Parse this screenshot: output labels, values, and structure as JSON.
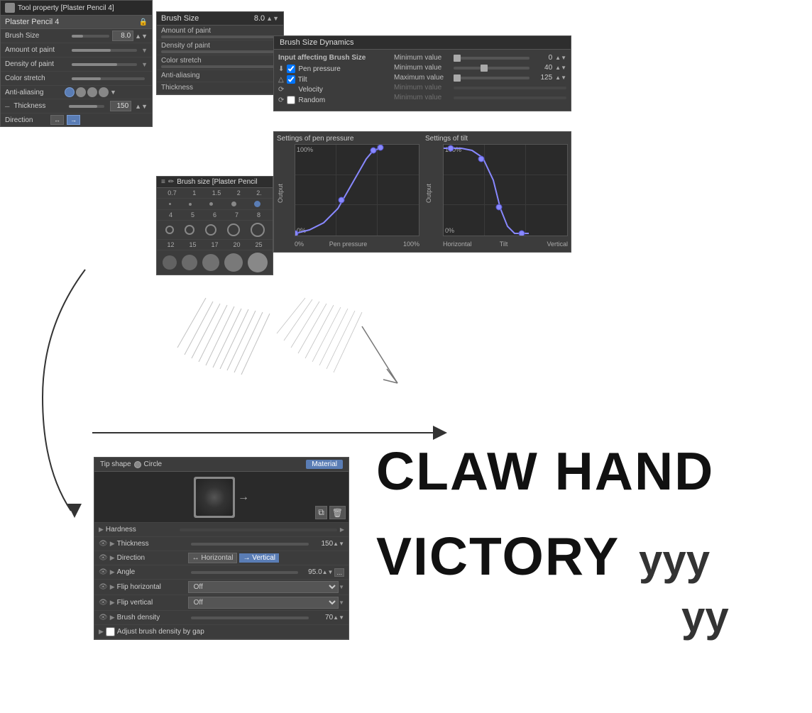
{
  "tool_property": {
    "title": "Tool property [Plaster Pencil 4]",
    "brush_name": "Plaster Pencil 4",
    "brush_size_label": "Brush Size",
    "brush_size_value": "8.0",
    "amount_of_paint_label": "Amount ot paint",
    "density_of_paint_label": "Density of paint",
    "color_stretch_label": "Color stretch",
    "anti_aliasing_label": "Anti-aliasing",
    "thickness_label": "Thickness",
    "thickness_value": "150",
    "direction_label": "Direction"
  },
  "brush_size_panel": {
    "title": "Brush Size",
    "value": "8.0",
    "amount_label": "Amount of paint",
    "density_label": "Density of paint",
    "color_stretch_label": "Color stretch",
    "anti_aliasing_label": "Anti-aliasing",
    "thickness_label": "Thickness"
  },
  "brush_size_dynamics": {
    "title": "Brush Size Dynamics",
    "input_section_label": "Input affecting Brush Size",
    "pen_pressure_label": "Pen pressure",
    "tilt_label": "Tilt",
    "velocity_label": "Velocity",
    "random_label": "Random",
    "min_value_label1": "Minimum value",
    "min_value_1": "0",
    "min_value_label2": "Minimum value",
    "min_value_2": "40",
    "max_value_label": "Maximum value",
    "max_value": "125",
    "min_value_label3": "Minimum value",
    "min_value_label4": "Minimum value"
  },
  "graphs": {
    "pen_pressure_title": "Settings of pen pressure",
    "tilt_title": "Settings of tilt",
    "output_label": "Output",
    "pen_pressure_100_top": "100%",
    "pen_pressure_0_bot": "0%",
    "pen_pressure_x_left": "0%",
    "pen_pressure_x_mid": "Pen pressure",
    "pen_pressure_x_right": "100%",
    "tilt_100_top": "100%",
    "tilt_0_bot": "0%",
    "tilt_x_left": "Horizontal",
    "tilt_x_mid": "Tilt",
    "tilt_x_right": "Vertical"
  },
  "brush_presets": {
    "title": "Brush size [Plaster Pencil",
    "sizes": [
      "0.7",
      "1",
      "1.5",
      "2",
      "2."
    ],
    "sizes2": [
      "4",
      "5",
      "6",
      "7",
      "8"
    ],
    "sizes3": [
      "12",
      "15",
      "17",
      "20",
      "25"
    ]
  },
  "tip_shape": {
    "title": "Tip shape",
    "circle_label": "Circle",
    "material_label": "Material",
    "hardness_label": "Hardness",
    "thickness_label": "Thickness",
    "thickness_value": "150",
    "direction_label": "Direction",
    "direction_horizontal": "↔ Horizontal",
    "direction_vertical": "→ Vertical",
    "angle_label": "Angle",
    "angle_value": "95.0",
    "flip_horizontal_label": "Flip horizontal",
    "flip_horizontal_value": "Off",
    "flip_vertical_label": "Flip vertical",
    "flip_vertical_value": "Off",
    "brush_density_label": "Brush density",
    "brush_density_value": "70",
    "adjust_label": "Adjust brush density by gap"
  },
  "claw_text": "CLAW HAND\nVICTORY yyy\n        yy"
}
